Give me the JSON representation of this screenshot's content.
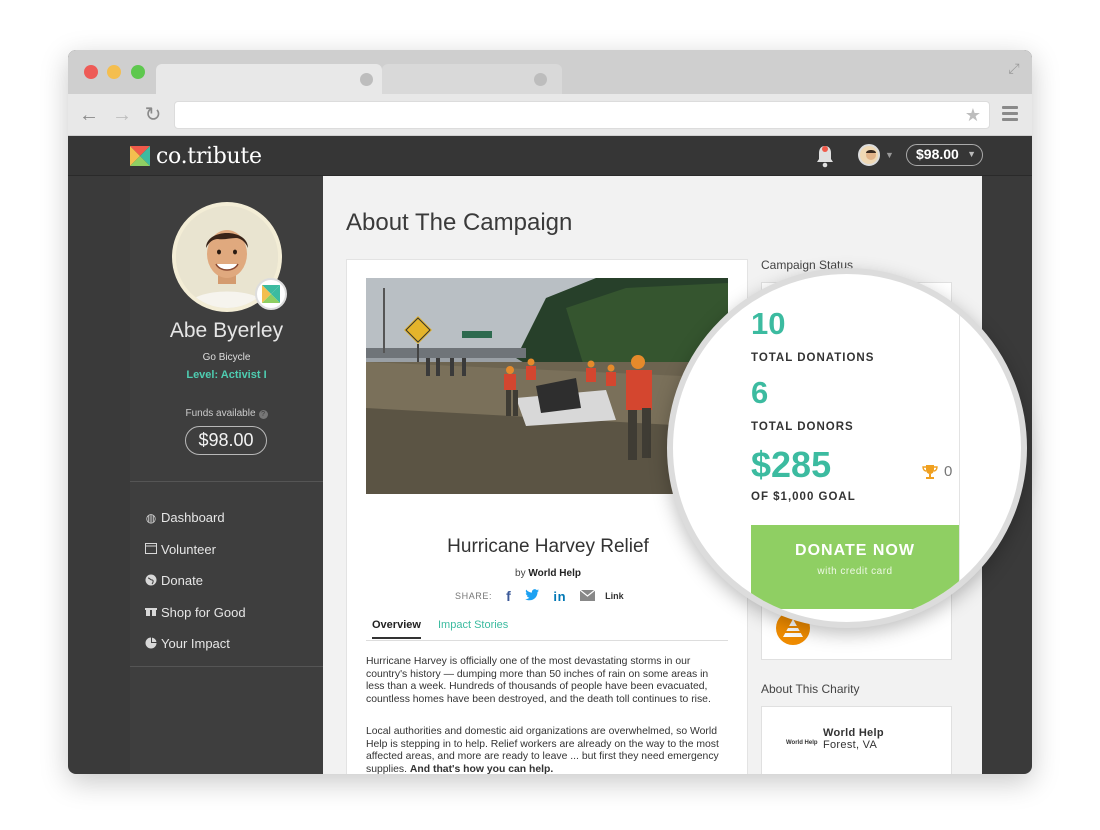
{
  "browser": {
    "colors": {
      "close": "#ee5b57",
      "minimize": "#f4be4f",
      "maximize": "#5ec84e"
    },
    "icons": [
      "back-arrow-icon",
      "forward-arrow-icon",
      "reload-icon",
      "star-icon",
      "menu-icon",
      "expand-icon"
    ]
  },
  "app": {
    "logo_text": "co.tribute",
    "top_balance": "$98.00",
    "accent_color": "#3cbba0"
  },
  "sidebar": {
    "name": "Abe Byerley",
    "cause": "Go Bicycle",
    "level": "Level: Activist I",
    "funds_label": "Funds available",
    "funds": "$98.00",
    "nav": [
      {
        "label": "Dashboard",
        "icon": "dashboard-icon"
      },
      {
        "label": "Volunteer",
        "icon": "calendar-icon"
      },
      {
        "label": "Donate",
        "icon": "globe-icon"
      },
      {
        "label": "Shop for Good",
        "icon": "gift-icon"
      },
      {
        "label": "Your Impact",
        "icon": "pie-chart-icon"
      }
    ]
  },
  "main": {
    "page_title": "About The Campaign",
    "campaign": {
      "title": "Hurricane Harvey Relief",
      "by_prefix": "by",
      "by_org": "World Help",
      "share_label": "SHARE:",
      "link_label": "Link",
      "tabs": [
        "Overview",
        "Impact Stories"
      ],
      "paragraphs": [
        "Hurricane Harvey is officially one of the most devastating storms in our country's history — dumping more than 50 inches of rain on some areas in less than a week. Hundreds of thousands of people have been evacuated, countless homes have been destroyed, and the death toll continues to rise.",
        "Local authorities and domestic aid organizations are overwhelmed, so World Help is stepping in to help. Relief workers are already on the way to the most affected areas, and more are ready to leave ... but first they need emergency supplies."
      ],
      "paragraph_emphasis": "And that's how you can help."
    },
    "status": {
      "label": "Campaign Status",
      "total_donations": "10",
      "total_donations_label": "TOTAL DONATIONS",
      "total_donors": "6",
      "total_donors_label": "TOTAL DONORS",
      "raised": "$285",
      "goal_label": "OF $1,000 GOAL",
      "trophy_count": "0",
      "donate_label": "DONATE NOW",
      "donate_sub": "with credit card"
    },
    "charity": {
      "about_label": "About This Charity",
      "logo_text": "World Help",
      "name": "World Help",
      "location": "Forest, VA"
    }
  }
}
